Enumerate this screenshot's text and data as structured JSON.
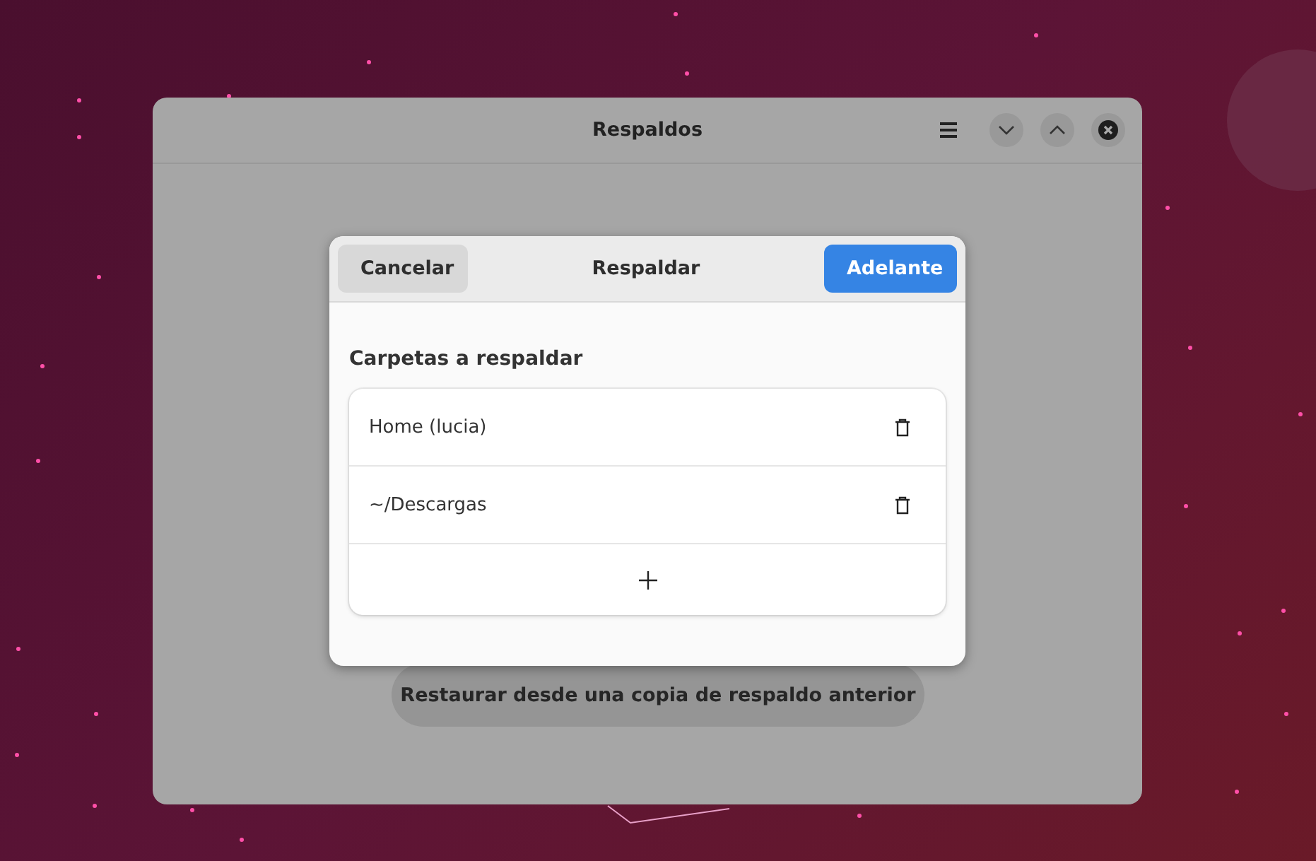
{
  "window": {
    "title": "Respaldos"
  },
  "restore_button": {
    "label": "Restaurar desde una copia de respaldo anterior"
  },
  "dialog": {
    "cancel_button": "Cancelar",
    "title": "Respaldar",
    "confirm_button": "Adelante",
    "section_title": "Carpetas a respaldar",
    "folders": [
      {
        "name": "Home (lucia)"
      },
      {
        "name": "~/Descargas"
      }
    ]
  }
}
